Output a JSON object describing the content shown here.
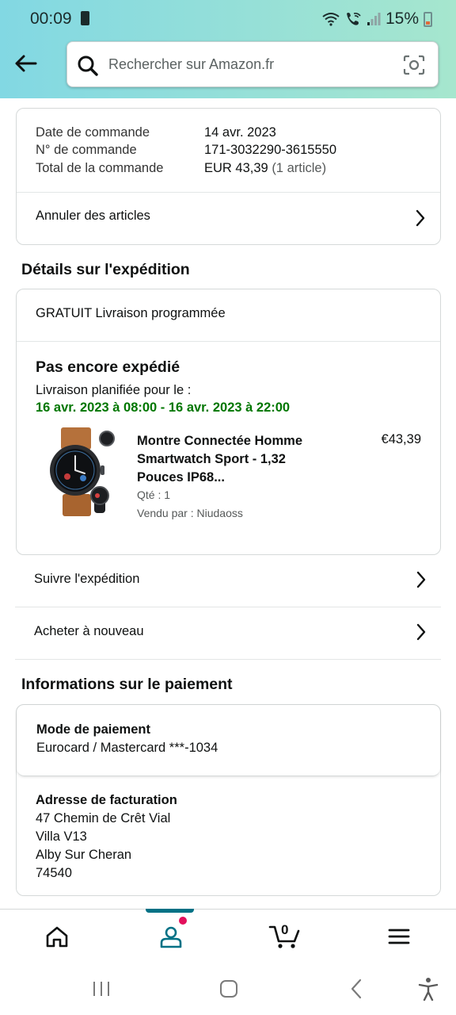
{
  "status_bar": {
    "time": "00:09",
    "battery": "15%"
  },
  "search": {
    "placeholder": "Rechercher sur Amazon.fr"
  },
  "order_summary": {
    "date_label": "Date de commande",
    "date_value": "14 avr. 2023",
    "number_label": "N° de commande",
    "number_value": "171-3032290-3615550",
    "total_label": "Total de la commande",
    "total_value": "EUR 43,39",
    "total_items": "(1 article)",
    "cancel_label": "Annuler des articles"
  },
  "shipping": {
    "section_title": "Détails sur l'expédition",
    "delivery_type": "GRATUIT Livraison programmée",
    "status": "Pas encore expédié",
    "planned_label": "Livraison planifiée pour le :",
    "planned_window": "16 avr. 2023 à 08:00 - 16 avr. 2023 à 22:00",
    "product": {
      "title": "Montre Connectée Homme Smartwatch Sport - 1,32 Pouces IP68...",
      "price": "€43,39",
      "qty": "Qté : 1",
      "seller": "Vendu par : Niudaoss"
    },
    "track_label": "Suivre l'expédition",
    "buy_again_label": "Acheter à nouveau"
  },
  "payment": {
    "section_title": "Informations sur le paiement",
    "method_label": "Mode de paiement",
    "method_value": "Eurocard / Mastercard  ***-1034",
    "billing_label": "Adresse de facturation",
    "billing_lines": [
      "47 Chemin de Crêt Vial",
      "Villa V13",
      "Alby Sur Cheran",
      "74540"
    ]
  },
  "bottom_nav": {
    "cart_count": "0",
    "active_tab": "account"
  },
  "colors": {
    "header_gradient_start": "#82d8e3",
    "header_gradient_end": "#a6e6ce",
    "delivery_green": "#007600",
    "tab_indicator": "#007185",
    "notification_dot": "#e3105c"
  }
}
